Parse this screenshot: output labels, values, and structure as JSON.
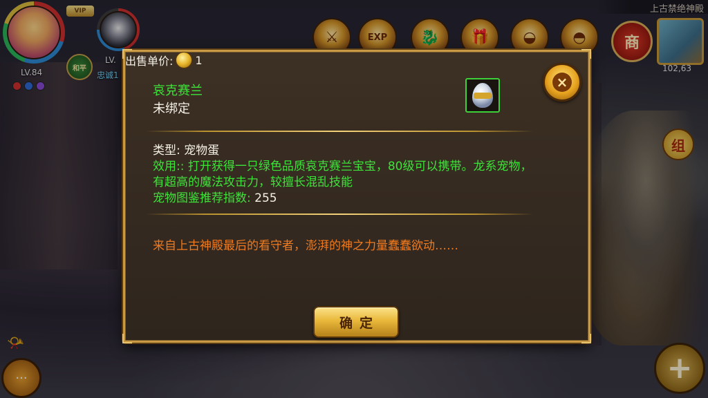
{
  "hud": {
    "player_level": "LV.84",
    "vip_label": "VIP",
    "pk_mode": "和平",
    "pet_level": "LV.",
    "pet_status": "忠诚1",
    "status_colors": [
      "#d23030",
      "#2f6ad6",
      "#8a4ad6"
    ]
  },
  "top_bar": {
    "icons": [
      "sword-emblem-icon",
      "exp-icon",
      "dragon-icon",
      "gift-box-icon",
      "gold-ingot-icon",
      "genie-lamp-icon"
    ],
    "exp_label": "EXP",
    "shop_label": "商",
    "map_name": "上古禁绝神殿",
    "map_coords": "102,63"
  },
  "side": {
    "team_label": "组",
    "plus_label": "+",
    "chat_label": "···"
  },
  "dialog": {
    "item_name": "哀克赛兰",
    "bind_status": "未绑定",
    "type_line": "类型: 宠物蛋",
    "effect_text": "效用:: 打开获得一只绿色品质哀克赛兰宝宝，80级可以携带。龙系宠物，有超高的魔法攻击力，较擅长混乱技能",
    "index_label": "宠物图鉴推荐指数:",
    "index_value": "255",
    "price_label": "出售单价:",
    "price_value": "1",
    "flavor_text": "来自上古神殿最后的看守者，澎湃的神之力量蠢蠢欲动……",
    "confirm_label": "确定",
    "close_label": "×",
    "colors": {
      "name_green": "#3ee33a",
      "flavor_orange": "#f07a1e",
      "border_gold": "#c89a44"
    }
  }
}
